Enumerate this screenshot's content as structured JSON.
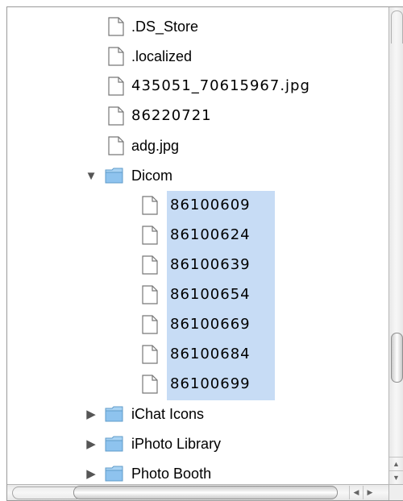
{
  "tree": {
    "files_root": [
      {
        "label": ".DS_Store",
        "icon": "document-icon"
      },
      {
        "label": ".localized",
        "icon": "document-icon"
      },
      {
        "label": "435051_70615967.jpg",
        "icon": "document-icon"
      },
      {
        "label": "86220721",
        "icon": "document-icon"
      },
      {
        "label": "adg.jpg",
        "icon": "document-icon"
      }
    ],
    "dicom": {
      "label": "Dicom",
      "expanded": true,
      "icon": "folder-icon",
      "children": [
        {
          "label": "86100609",
          "selected": true
        },
        {
          "label": "86100624",
          "selected": true
        },
        {
          "label": "86100639",
          "selected": true
        },
        {
          "label": "86100654",
          "selected": true
        },
        {
          "label": "86100669",
          "selected": true
        },
        {
          "label": "86100684",
          "selected": true
        },
        {
          "label": "86100699",
          "selected": true
        }
      ]
    },
    "folders": [
      {
        "label": "iChat Icons",
        "expanded": false
      },
      {
        "label": "iPhoto Library",
        "expanded": false
      },
      {
        "label": "Photo Booth",
        "expanded": false
      }
    ]
  },
  "colors": {
    "selection": "#c7dcf5",
    "folder": "#8ec3ee",
    "border": "#9a9a9a"
  },
  "scrollbars": {
    "up_arrow": "▲",
    "down_arrow": "▼",
    "left_arrow": "◀",
    "right_arrow": "▶"
  }
}
